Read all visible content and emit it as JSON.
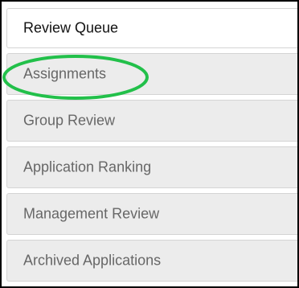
{
  "nav": {
    "items": [
      {
        "label": "Review Queue",
        "active": true
      },
      {
        "label": "Assignments",
        "active": false
      },
      {
        "label": "Group Review",
        "active": false
      },
      {
        "label": "Application Ranking",
        "active": false
      },
      {
        "label": "Management Review",
        "active": false
      },
      {
        "label": "Archived Applications",
        "active": false
      }
    ]
  },
  "annotation": {
    "highlighted_item": "Assignments",
    "color": "#22c04a"
  }
}
